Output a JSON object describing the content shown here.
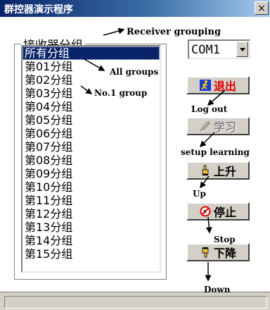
{
  "window": {
    "title": "群控器演示程序",
    "close_glyph": "×"
  },
  "group_box": {
    "title": "接收器分组"
  },
  "groups_list": {
    "items": [
      "所有分组",
      "第01分组",
      "第02分组",
      "第03分组",
      "第04分组",
      "第05分组",
      "第06分组",
      "第07分组",
      "第08分组",
      "第09分组",
      "第10分组",
      "第11分组",
      "第12分组",
      "第13分组",
      "第14分组",
      "第15分组"
    ],
    "selected_index": 0
  },
  "port_select": {
    "value": "COM1"
  },
  "buttons": {
    "exit": {
      "label": "退出",
      "icon": "running-person-icon"
    },
    "learn": {
      "label": "学习",
      "icon": "pen-icon",
      "enabled": false
    },
    "up": {
      "label": "上升",
      "icon": "hand-up-icon"
    },
    "stop": {
      "label": "停止",
      "icon": "no-sign-icon"
    },
    "down": {
      "label": "下降",
      "icon": "hand-down-icon"
    }
  },
  "annotations": {
    "receiver_grouping": "Receiver grouping",
    "all_groups": "All groups",
    "no1_group": "No.1 group",
    "log_out": "Log out",
    "setup_learning": "setup learning",
    "up": "Up",
    "stop": "Stop",
    "down": "Down"
  },
  "colors": {
    "title_bar": "#0a246a",
    "selection": "#0a246a",
    "exit_label": "#e00000",
    "face": "#d4d0c8"
  }
}
